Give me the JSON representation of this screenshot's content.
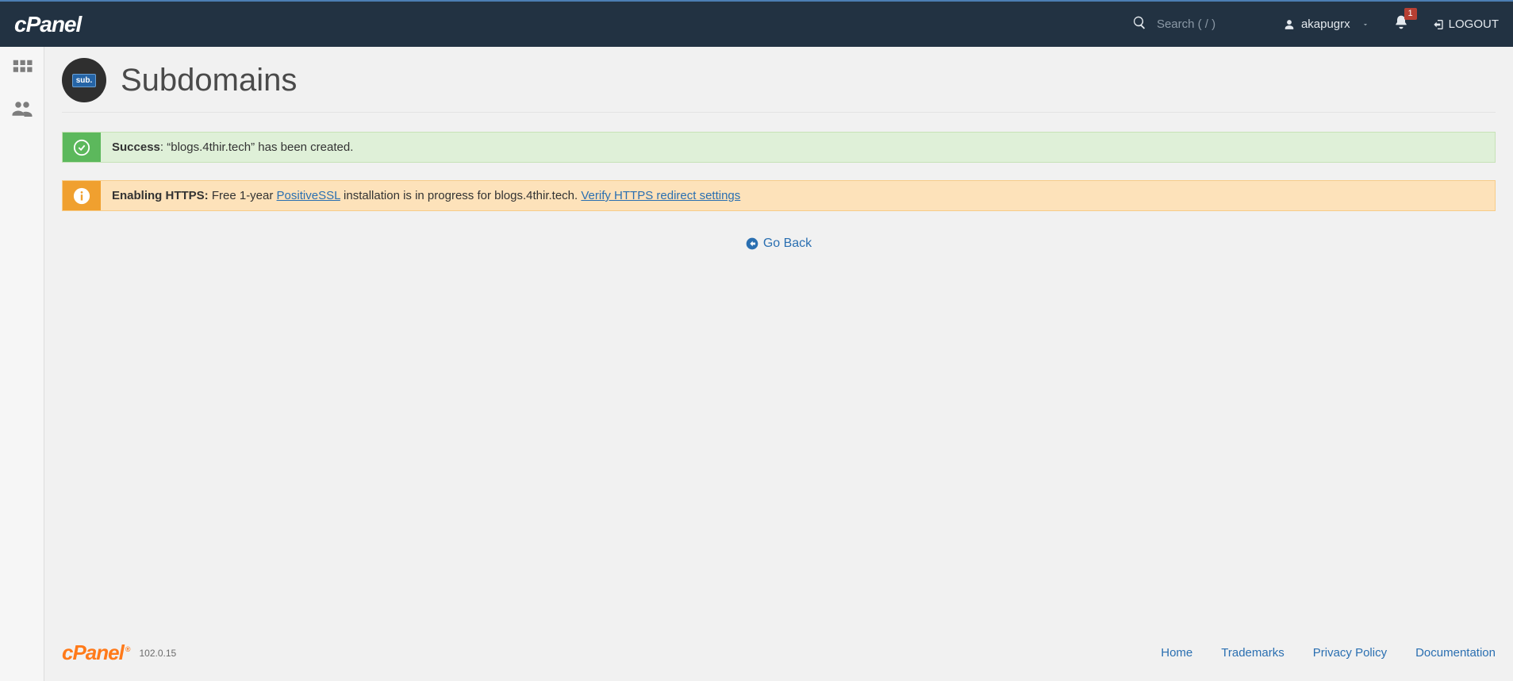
{
  "header": {
    "logo_text": "cPanel",
    "search_placeholder": "Search ( / )",
    "username": "akapugrx",
    "notification_count": "1",
    "logout_label": "LOGOUT"
  },
  "page": {
    "icon_label": "sub.",
    "title": "Subdomains"
  },
  "alerts": {
    "success": {
      "label": "Success",
      "message": ": “blogs.4thir.tech” has been created."
    },
    "info": {
      "label": "Enabling HTTPS:",
      "pre": " Free 1-year ",
      "link1_text": "PositiveSSL",
      "mid": " installation is in progress for blogs.4thir.tech. ",
      "link2_text": "Verify HTTPS redirect settings"
    }
  },
  "go_back_label": "Go Back",
  "footer": {
    "logo_text": "cPanel",
    "version": "102.0.15",
    "links": {
      "home": "Home",
      "trademarks": "Trademarks",
      "privacy": "Privacy Policy",
      "docs": "Documentation"
    }
  }
}
